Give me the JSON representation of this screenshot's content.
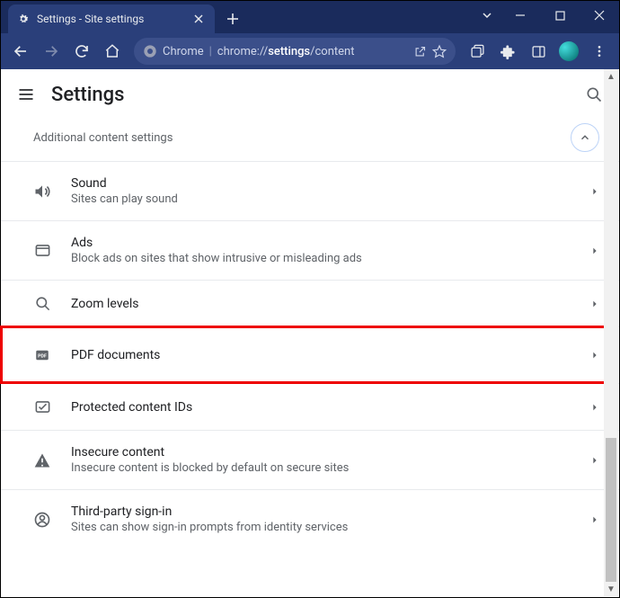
{
  "window": {
    "tab_title": "Settings - Site settings"
  },
  "omnibox": {
    "host_label": "Chrome",
    "url_prefix": "chrome://",
    "url_bold": "settings",
    "url_suffix": "/content"
  },
  "appbar": {
    "title": "Settings"
  },
  "section": {
    "header": "Additional content settings"
  },
  "rows": {
    "sound": {
      "name": "Sound",
      "desc": "Sites can play sound"
    },
    "ads": {
      "name": "Ads",
      "desc": "Block ads on sites that show intrusive or misleading ads"
    },
    "zoom": {
      "name": "Zoom levels"
    },
    "pdf": {
      "name": "PDF documents"
    },
    "protected": {
      "name": "Protected content IDs"
    },
    "insecure": {
      "name": "Insecure content",
      "desc": "Insecure content is blocked by default on secure sites"
    },
    "thirdparty": {
      "name": "Third-party sign-in",
      "desc": "Sites can show sign-in prompts from identity services"
    }
  },
  "highlighted_row": "pdf"
}
